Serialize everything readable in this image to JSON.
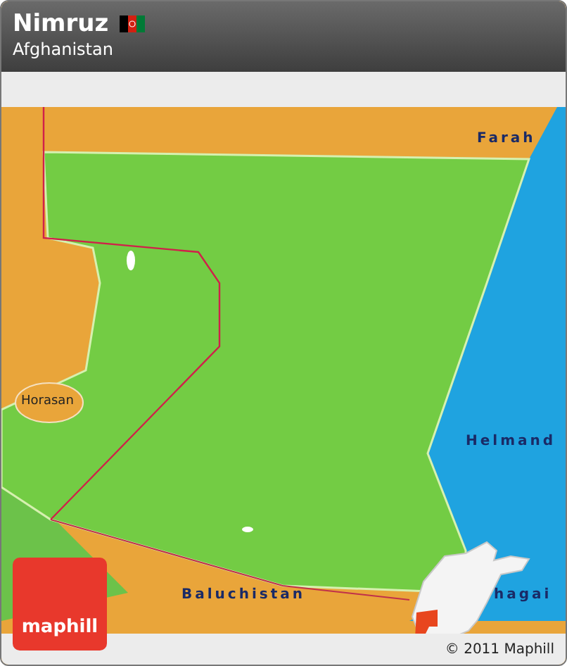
{
  "header": {
    "title": "Nimruz",
    "subtitle": "Afghanistan"
  },
  "map": {
    "labels": [
      {
        "text": "Farah",
        "kind": "region"
      },
      {
        "text": "Helmand",
        "kind": "region"
      },
      {
        "text": "Horasan",
        "kind": "place"
      },
      {
        "text": "Baluchistan",
        "kind": "region"
      },
      {
        "text": "hagai",
        "kind": "region"
      }
    ]
  },
  "logo": {
    "text": "maphill"
  },
  "footer": {
    "copyright": "© 2011 Maphill"
  }
}
